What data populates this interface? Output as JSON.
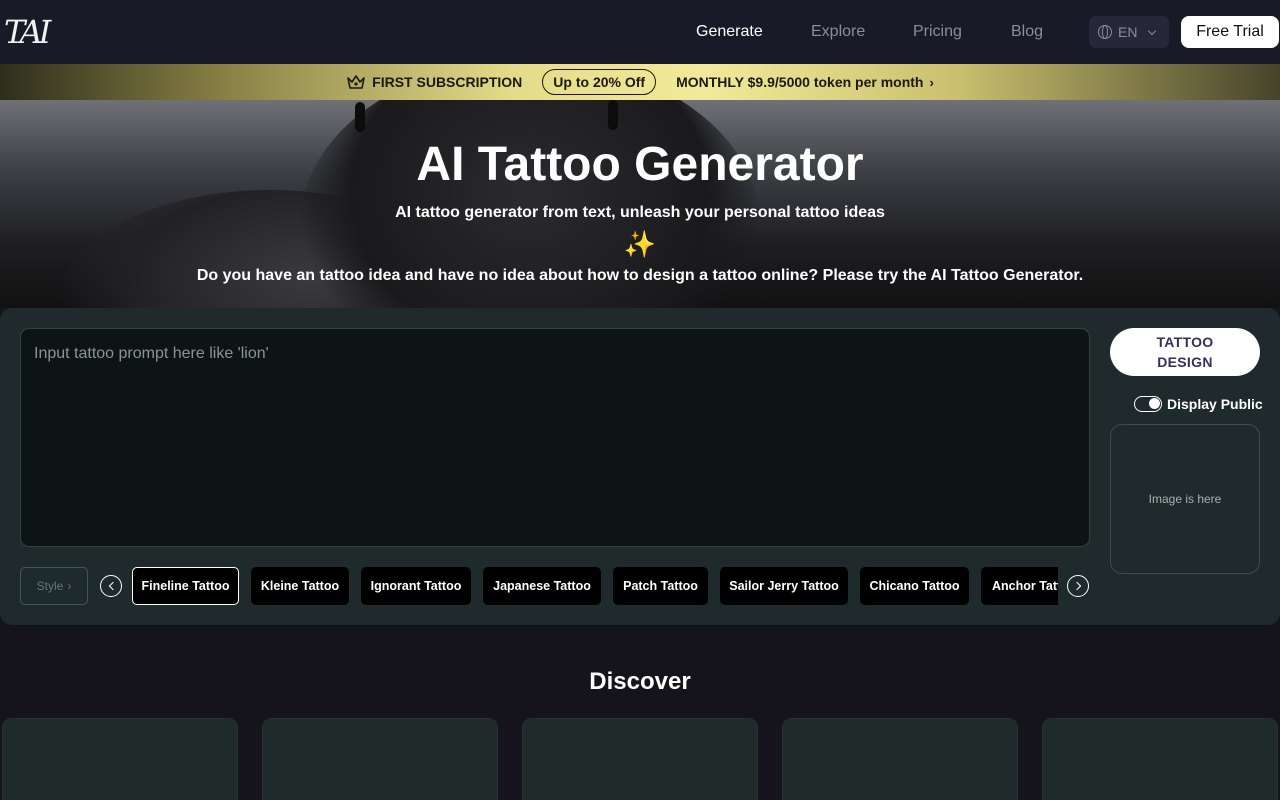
{
  "header": {
    "logo": "TAI",
    "nav": [
      "Generate",
      "Explore",
      "Pricing",
      "Blog"
    ],
    "language": "EN",
    "free_trial": "Free Trial"
  },
  "promo": {
    "label": "FIRST SUBSCRIPTION",
    "discount": "Up to 20% Off",
    "offer": "MONTHLY $9.9/5000 token per month"
  },
  "hero": {
    "title": "AI Tattoo Generator",
    "subtitle": "AI tattoo generator from text, unleash your personal tattoo ideas",
    "sparkle": "✨",
    "question": "Do you have an tattoo idea and have no idea about how to design a tattoo online? Please try the AI Tattoo Generator."
  },
  "generator": {
    "prompt_placeholder": "Input tattoo prompt here like 'lion'",
    "design_button": "TATTOO DESIGN",
    "display_public_label": "Display Public",
    "display_public_on": true,
    "image_placeholder": "Image is here",
    "style_button": "Style",
    "styles": [
      "Fineline Tattoo",
      "Kleine Tattoo",
      "Ignorant Tattoo",
      "Japanese Tattoo",
      "Patch Tattoo",
      "Sailor Jerry Tattoo",
      "Chicano Tattoo",
      "Anchor Tattoo"
    ],
    "selected_style": "Fineline Tattoo"
  },
  "discover": {
    "title": "Discover"
  },
  "colors": {
    "header_bg": "#191a28",
    "panel_bg": "#1e2a2b",
    "promo_gold": "#e4db8a"
  }
}
